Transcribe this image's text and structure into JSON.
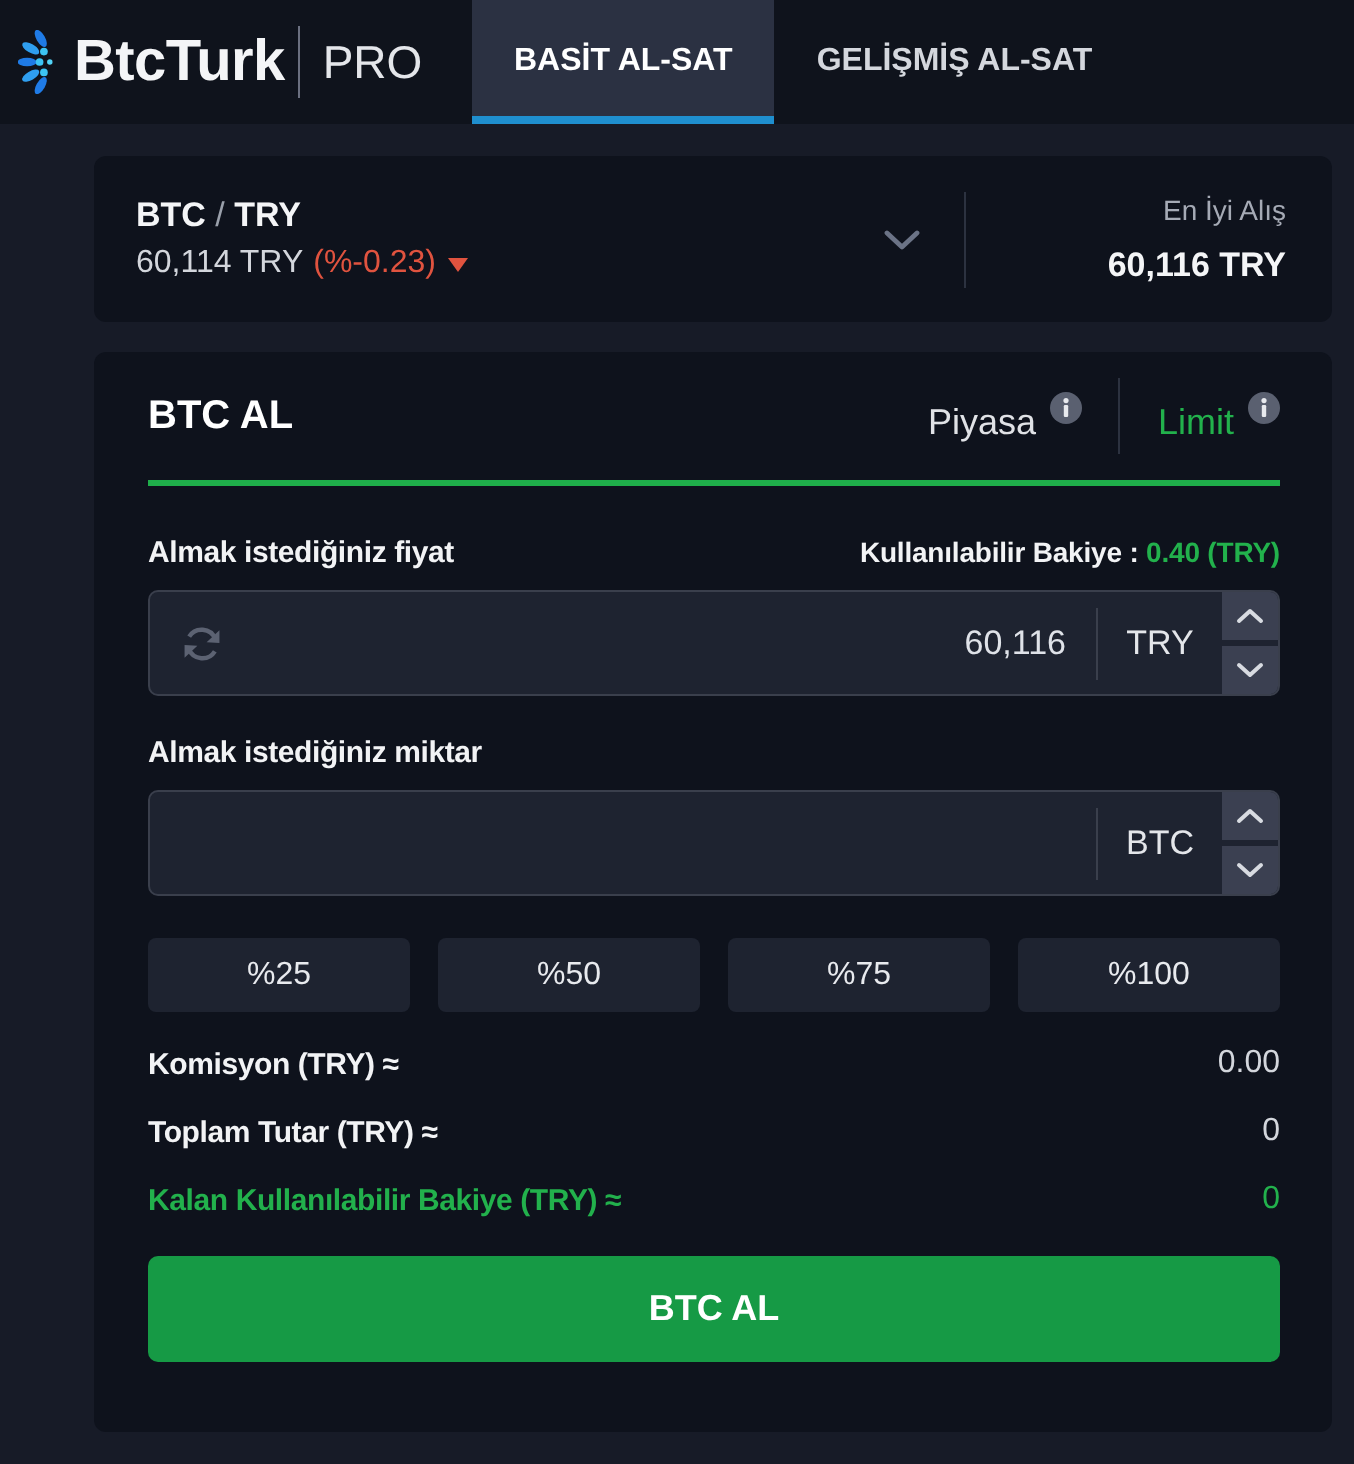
{
  "header": {
    "logo": {
      "name": "BtcTurk",
      "suffix": "PRO"
    },
    "tabs": [
      {
        "label": "BASİT AL-SAT",
        "selected": true
      },
      {
        "label": "GELİŞMİŞ AL-SAT",
        "selected": false
      }
    ]
  },
  "pair": {
    "base": "BTC",
    "separator": "/",
    "quote": "TRY",
    "last_price": "60,114 TRY",
    "change": "(%-0.23)",
    "falling": true,
    "best_bid_label": "En İyi Alış",
    "best_bid": "60,116 TRY"
  },
  "order_form": {
    "title": "BTC AL",
    "order_types": [
      {
        "label": "Piyasa",
        "selected": false
      },
      {
        "label": "Limit",
        "selected": true
      }
    ],
    "price_label": "Almak istediğiniz fiyat",
    "balance_label": "Kullanılabilir Bakiye :",
    "balance_value": "0.40 (TRY)",
    "price_field": {
      "value": "60,116",
      "unit": "TRY"
    },
    "amount_label": "Almak istediğiniz miktar",
    "amount_field": {
      "unit": "BTC"
    },
    "percent_buttons": [
      "%25",
      "%50",
      "%75",
      "%100"
    ],
    "summary": [
      {
        "label": "Komisyon (TRY) ≈",
        "value": "0.00",
        "highlighted": false
      },
      {
        "label": "Toplam Tutar (TRY) ≈",
        "value": "0",
        "highlighted": false
      },
      {
        "label": "Kalan Kullanılabilir Bakiye (TRY) ≈",
        "value": "0",
        "highlighted": true
      }
    ],
    "submit": "BTC AL"
  }
}
